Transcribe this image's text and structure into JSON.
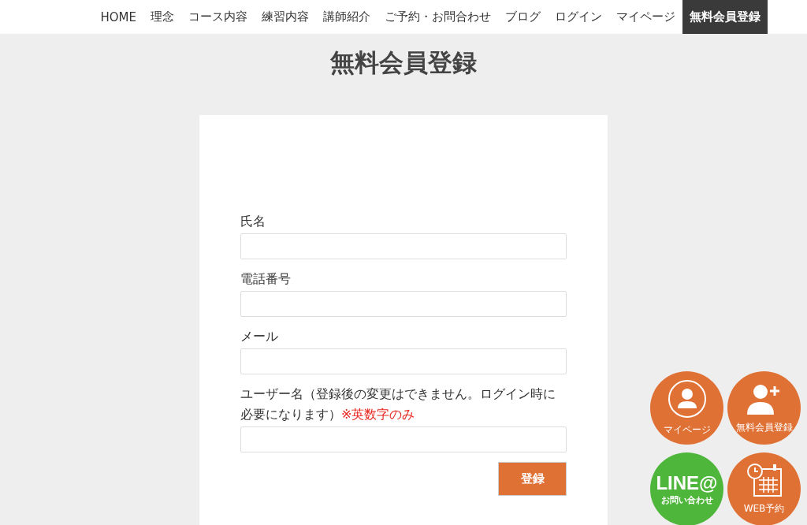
{
  "nav": [
    {
      "label": "HOME",
      "selected": false
    },
    {
      "label": "理念",
      "selected": false
    },
    {
      "label": "コース内容",
      "selected": false
    },
    {
      "label": "練習内容",
      "selected": false
    },
    {
      "label": "講師紹介",
      "selected": false
    },
    {
      "label": "ご予約・お問合わせ",
      "selected": false
    },
    {
      "label": "ブログ",
      "selected": false
    },
    {
      "label": "ログイン",
      "selected": false
    },
    {
      "label": "マイページ",
      "selected": false
    },
    {
      "label": "無料会員登録",
      "selected": true
    }
  ],
  "page_title": "無料会員登録",
  "form": {
    "fields": [
      {
        "label": "氏名"
      },
      {
        "label": "電話番号"
      },
      {
        "label": "メール"
      },
      {
        "label": "ユーザー名（登録後の変更はできません。ログイン時に必要になります）",
        "note": "※英数字のみ"
      }
    ],
    "submit": "登録"
  },
  "floating_buttons": [
    {
      "kind": "mypage",
      "label": "マイページ"
    },
    {
      "kind": "register",
      "label": "無料会員登録"
    },
    {
      "kind": "line",
      "title": "LINE@",
      "label": "お問い合わせ"
    },
    {
      "kind": "reserve",
      "label": "WEB予約"
    }
  ]
}
